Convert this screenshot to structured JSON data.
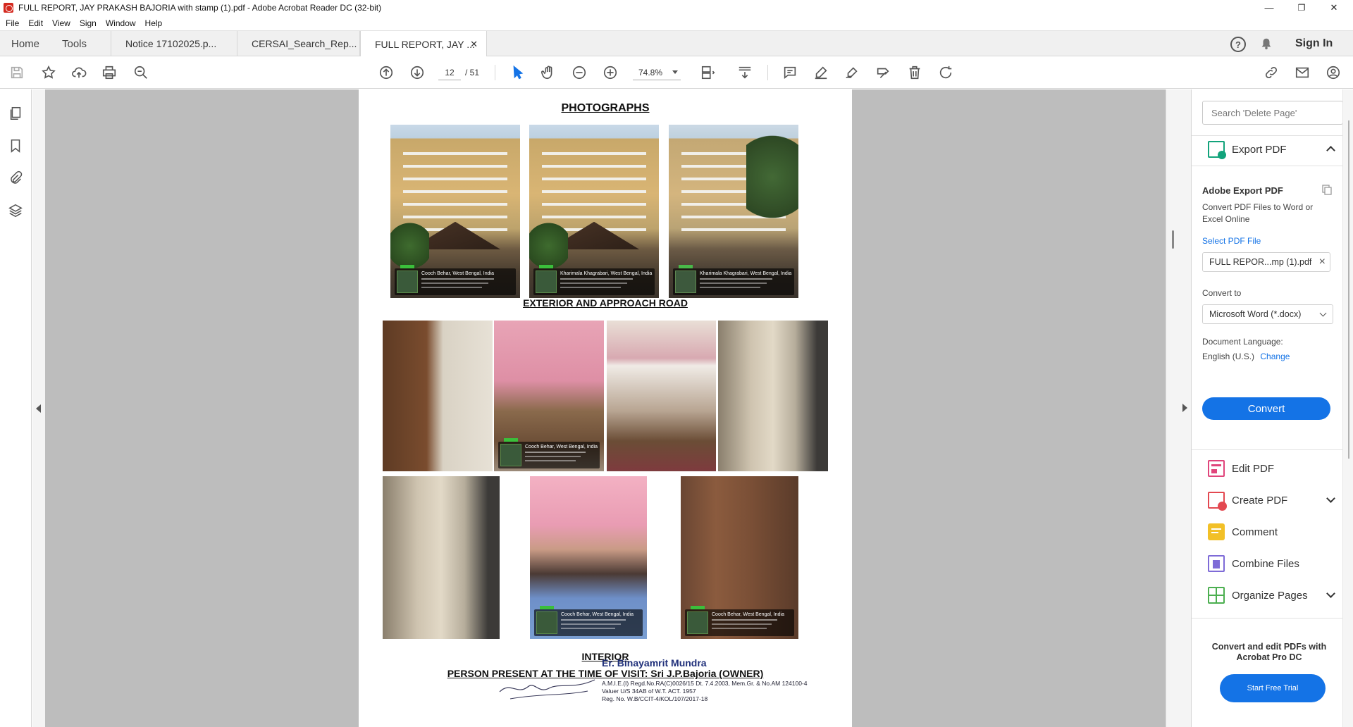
{
  "window": {
    "title": "FULL REPORT, JAY PRAKASH BAJORIA with stamp (1).pdf - Adobe Acrobat Reader DC (32-bit)",
    "minimize": "—",
    "maximize": "❐",
    "close": "✕"
  },
  "menu": [
    "File",
    "Edit",
    "View",
    "Sign",
    "Window",
    "Help"
  ],
  "tabs": {
    "home": "Home",
    "tools": "Tools",
    "docs": [
      {
        "label": "Notice 17102025.p..."
      },
      {
        "label": "CERSAI_Search_Rep..."
      },
      {
        "label": "FULL REPORT, JAY ..."
      }
    ],
    "close_glyph": "✕",
    "help": "?",
    "signin": "Sign In"
  },
  "toolbar": {
    "page_current": "12",
    "page_total": "/ 51",
    "zoom": "74.8%"
  },
  "document": {
    "heading_photos": "PHOTOGRAPHS",
    "caption_exterior": "EXTERIOR AND APPROACH ROAD",
    "caption_interior": "INTERIOR",
    "caption_person": "PERSON PRESENT AT THE TIME OF VISIT: Sri J.P.Bajoria (OWNER)",
    "stamp_text_1": "Cooch Behar, West Bengal, India",
    "stamp_text_2": "Kharimala Khagrabari, West Bengal, India",
    "stamp_text_3": "Kharimala Khagrabari, West Bengal, India",
    "stamp_text_4": "Cooch Behar, West Bengal, India",
    "stamp_text_5": "Cooch Behar, West Bengal, India",
    "stamp_text_6": "Cooch Behar, West Bengal, India",
    "signature": {
      "name": "Er. Binayamrit Mundra",
      "line1": "A.M.I.E.(I) Regd.No.RA(C)0026/15 Dt. 7.4.2003, Mem.Gr. & No.AM 124100-4",
      "line2": "Valuer U/S 34AB of W.T. ACT. 1957",
      "line3": "Reg. No. W.B/CCIT-4/KOL/107/2017-18"
    }
  },
  "right_panel": {
    "search_placeholder": "Search 'Delete Page'",
    "export_pdf": "Export PDF",
    "adobe_export_title": "Adobe Export PDF",
    "adobe_export_desc": "Convert PDF Files to Word or Excel Online",
    "select_pdf_file": "Select PDF File",
    "selected_file": "FULL REPOR...mp (1).pdf",
    "convert_to_label": "Convert to",
    "convert_to_value": "Microsoft Word (*.docx)",
    "doc_language_label": "Document Language:",
    "doc_language_value": "English (U.S.)",
    "change": "Change",
    "convert_button": "Convert",
    "tools": [
      {
        "label": "Edit PDF"
      },
      {
        "label": "Create PDF"
      },
      {
        "label": "Comment"
      },
      {
        "label": "Combine Files"
      },
      {
        "label": "Organize Pages"
      }
    ],
    "promo_text": "Convert and edit PDFs with Acrobat Pro DC",
    "trial_button": "Start Free Trial"
  },
  "colors": {
    "accent": "#1473e6",
    "edit_pdf": "#e0457b",
    "create_pdf": "#e34850",
    "comment": "#f2c027",
    "combine": "#7e6bd7",
    "organize": "#4caf50",
    "export": "#12a37b"
  }
}
